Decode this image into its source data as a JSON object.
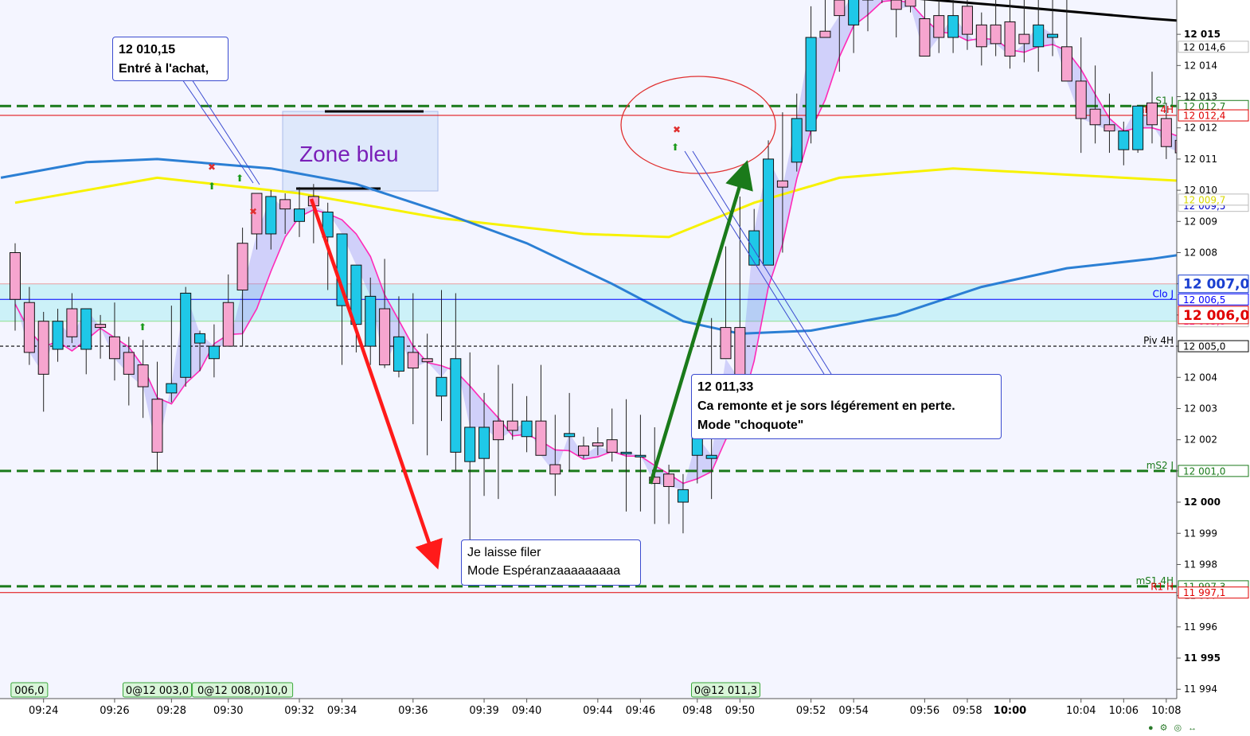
{
  "chart_data": {
    "type": "candlestick",
    "title": "",
    "xlabel": "",
    "ylabel": "",
    "ylim": [
      11993.7,
      12016.1
    ],
    "y_ticks": [
      "12 015",
      "12 014",
      "12 013",
      "12 012",
      "12 011",
      "12 010",
      "12 009",
      "12 008",
      "12 007",
      "12 006",
      "12 005",
      "12 004",
      "12 003",
      "12 002",
      "12 001",
      "12 000",
      "11 999",
      "11 998",
      "11 997",
      "11 996",
      "11 995",
      "11 994"
    ],
    "y_ticks_bold": [
      "12 015",
      "12 000",
      "11 995"
    ],
    "x_ticks": [
      {
        "label": "09:24",
        "idx": 2
      },
      {
        "label": "09:26",
        "idx": 7
      },
      {
        "label": "09:28",
        "idx": 11
      },
      {
        "label": "09:30",
        "idx": 15
      },
      {
        "label": "09:32",
        "idx": 20
      },
      {
        "label": "09:34",
        "idx": 23
      },
      {
        "label": "09:36",
        "idx": 28
      },
      {
        "label": "09:39",
        "idx": 33
      },
      {
        "label": "09:40",
        "idx": 36
      },
      {
        "label": "09:44",
        "idx": 41
      },
      {
        "label": "09:46",
        "idx": 44
      },
      {
        "label": "09:48",
        "idx": 48
      },
      {
        "label": "09:50",
        "idx": 51
      },
      {
        "label": "09:52",
        "idx": 56
      },
      {
        "label": "09:54",
        "idx": 59
      },
      {
        "label": "09:56",
        "idx": 64
      },
      {
        "label": "09:58",
        "idx": 67
      },
      {
        "label": "10:00",
        "idx": 70,
        "bold": true
      },
      {
        "label": "10:04",
        "idx": 75
      },
      {
        "label": "10:06",
        "idx": 78
      },
      {
        "label": "10:08",
        "idx": 81
      }
    ],
    "candles": [
      [
        12008.0,
        12008.3,
        12005.5,
        12006.5
      ],
      [
        12006.4,
        12006.9,
        12004.4,
        12004.8
      ],
      [
        12005.8,
        12006.1,
        12002.9,
        12004.1
      ],
      [
        12004.9,
        12006.2,
        12004.5,
        12005.8
      ],
      [
        12006.2,
        12006.7,
        12005.1,
        12005.3
      ],
      [
        12004.9,
        12006.2,
        12004.1,
        12006.2
      ],
      [
        12005.7,
        12006.0,
        12004.6,
        12005.6
      ],
      [
        12005.3,
        12006.4,
        12003.9,
        12004.6
      ],
      [
        12004.8,
        12005.3,
        12003.1,
        12004.1
      ],
      [
        12004.4,
        12005.2,
        12002.7,
        12003.7
      ],
      [
        12003.3,
        12004.5,
        12001.0,
        12001.6
      ],
      [
        12003.5,
        12006.3,
        12003.2,
        12003.8
      ],
      [
        12004.0,
        12006.9,
        12003.7,
        12006.7
      ],
      [
        12005.1,
        12005.5,
        12004.2,
        12005.4
      ],
      [
        12004.6,
        12005.7,
        12004.0,
        12005.0
      ],
      [
        12006.4,
        12007.3,
        12005.6,
        12005.0
      ],
      [
        12008.3,
        12008.8,
        12005.0,
        12006.8
      ],
      [
        12009.9,
        12009.9,
        12008.1,
        12008.6
      ],
      [
        12008.6,
        12010.0,
        12008.1,
        12009.8
      ],
      [
        12009.7,
        12009.9,
        12008.6,
        12009.4
      ],
      [
        12009.0,
        12010.1,
        12008.5,
        12009.4
      ],
      [
        12009.8,
        12010.2,
        12008.3,
        12009.5
      ],
      [
        12008.5,
        12009.6,
        12006.8,
        12009.3
      ],
      [
        12006.3,
        12007.2,
        12004.4,
        12008.6
      ],
      [
        12005.7,
        12007.6,
        12004.8,
        12007.6
      ],
      [
        12005.0,
        12007.2,
        12004.4,
        12006.6
      ],
      [
        12006.2,
        12007.8,
        12004.3,
        12004.4
      ],
      [
        12004.2,
        12006.6,
        12004.0,
        12005.3
      ],
      [
        12004.8,
        12006.7,
        12002.5,
        12004.3
      ],
      [
        12004.6,
        12005.4,
        12001.5,
        12004.5
      ],
      [
        12003.4,
        12006.8,
        12002.6,
        12004.0
      ],
      [
        12001.6,
        12006.7,
        12001.0,
        12004.6
      ],
      [
        12001.3,
        12004.8,
        11998.1,
        12002.4
      ],
      [
        12001.4,
        12003.5,
        12000.2,
        12002.4
      ],
      [
        12002.6,
        12004.4,
        12000.1,
        12002.0
      ],
      [
        12002.6,
        12003.8,
        12002.0,
        12002.3
      ],
      [
        12002.1,
        12003.4,
        12001.6,
        12002.6
      ],
      [
        12002.6,
        12004.4,
        12001.6,
        12001.5
      ],
      [
        12001.2,
        12002.8,
        12000.2,
        12000.9
      ],
      [
        12002.1,
        12003.5,
        12001.0,
        12002.2
      ],
      [
        12001.8,
        12002.1,
        12001.4,
        12001.5
      ],
      [
        12001.9,
        12002.4,
        12001.5,
        12001.8
      ],
      [
        12002.0,
        12003.0,
        12001.3,
        12001.6
      ],
      [
        12001.6,
        12003.3,
        11999.7,
        12001.6
      ],
      [
        12001.5,
        12002.8,
        11999.7,
        12001.5
      ],
      [
        12000.8,
        12002.4,
        11999.3,
        12000.6
      ],
      [
        12000.9,
        12001.2,
        11999.3,
        12000.5
      ],
      [
        12000.0,
        12000.9,
        11999.0,
        12000.4
      ],
      [
        12001.5,
        12003.3,
        12000.6,
        12002.1
      ],
      [
        12001.4,
        12005.9,
        12000.1,
        12001.5
      ],
      [
        12005.6,
        12008.2,
        12005.6,
        12004.6
      ],
      [
        12005.6,
        12009.8,
        12005.3,
        12003.9
      ],
      [
        12007.6,
        12009.4,
        12007.6,
        12008.7
      ],
      [
        12007.6,
        12011.6,
        12007.6,
        12011.0
      ],
      [
        12010.3,
        12012.5,
        12008.0,
        12010.1
      ],
      [
        12010.9,
        12013.1,
        12010.6,
        12012.3
      ],
      [
        12011.9,
        12015.9,
        12011.5,
        12014.9
      ],
      [
        12015.1,
        12016.8,
        12014.9,
        12014.9
      ],
      [
        12016.1,
        12016.9,
        12013.8,
        12015.6
      ],
      [
        12015.3,
        12016.9,
        12014.4,
        12016.3
      ],
      [
        12016.1,
        12017.6,
        12015.1,
        12016.3
      ],
      [
        12016.5,
        12017.8,
        12016.0,
        12016.6
      ],
      [
        12016.1,
        12017.0,
        12014.9,
        12015.8
      ],
      [
        12016.5,
        12017.9,
        12015.7,
        12015.9
      ],
      [
        12015.5,
        12016.2,
        12014.8,
        12014.3
      ],
      [
        12015.6,
        12016.2,
        12014.4,
        12014.9
      ],
      [
        12014.9,
        12016.3,
        12014.4,
        12015.6
      ],
      [
        12015.9,
        12016.7,
        12014.5,
        12015.0
      ],
      [
        12015.3,
        12015.7,
        12014.0,
        12014.6
      ],
      [
        12015.3,
        12016.2,
        12014.3,
        12014.7
      ],
      [
        12015.4,
        12016.7,
        12013.9,
        12014.3
      ],
      [
        12015.0,
        12016.2,
        12014.1,
        12014.7
      ],
      [
        12014.6,
        12016.2,
        12013.8,
        12015.3
      ],
      [
        12014.9,
        12016.2,
        12014.3,
        12015.0
      ],
      [
        12014.6,
        12016.1,
        12013.6,
        12013.5
      ],
      [
        12013.5,
        12014.9,
        12011.2,
        12012.3
      ],
      [
        12012.6,
        12014.0,
        12011.5,
        12012.1
      ],
      [
        12012.1,
        12013.1,
        12011.2,
        12011.9
      ],
      [
        12011.3,
        12012.2,
        12010.8,
        12011.9
      ],
      [
        12011.3,
        12012.2,
        12011.2,
        12012.7
      ],
      [
        12012.8,
        12013.8,
        12011.5,
        12012.1
      ],
      [
        12012.3,
        12012.8,
        12011.0,
        12011.4
      ],
      [
        12011.6,
        12012.6,
        12011.3,
        12011.2
      ]
    ],
    "candles_note": "",
    "series": [
      {
        "name": "",
        "color": "#ff2ab8"
      },
      {
        "name": "",
        "color": "#f7f200"
      },
      {
        "name": "",
        "color": "#2b7fd4"
      },
      {
        "name": "",
        "color": "#000000"
      }
    ],
    "levels": [
      {
        "label": "S1 J",
        "value": 12012.7,
        "box": "12 012,7",
        "color": "#1a7a1a",
        "style": "dashed"
      },
      {
        "label": "mR1 4H",
        "value": 12012.4,
        "box": "12 012,4",
        "color": "#e00000",
        "style": "solid"
      },
      {
        "label": "Clo J",
        "value": 12006.5,
        "box": "12 006,5",
        "color": "#0000ff",
        "style": "solid"
      },
      {
        "label": "Piv 4H",
        "value": 12005.0,
        "box": "12 005,0",
        "color": "#000000",
        "style": "dotted"
      },
      {
        "label": "mS2 J",
        "value": 12001.0,
        "box": "12 001,0",
        "color": "#1a7a1a",
        "style": "dashed"
      },
      {
        "label": "mS1 4H",
        "value": 11997.3,
        "box": "11 997,3",
        "color": "#1a7a1a",
        "style": "dashed"
      },
      {
        "label": "R1 H",
        "value": 11997.1,
        "box": "11 997,1",
        "color": "#e00000",
        "style": "solid"
      }
    ],
    "price_labels": [
      {
        "text": "12 014,6",
        "value": 12014.6,
        "color": "#000000",
        "bg": "#ffffff"
      },
      {
        "text": "12 009,5",
        "value": 12009.5,
        "color": "#0000cc",
        "bg": "#ffffff"
      },
      {
        "text": "12 009,7",
        "value": 12009.7,
        "color": "#d8d800",
        "bg": "#ffffff"
      },
      {
        "text": "12 005,8",
        "value": 12005.8,
        "color": "#ff2ab8",
        "bg": "#ffffff"
      },
      {
        "text": "12 007,0",
        "value": 12007.0,
        "color": "#1a3fd0",
        "bg": "#ffffff",
        "big": true
      },
      {
        "text": "12 006,0",
        "value": 12006.0,
        "color": "#e00000",
        "bg": "#ffffff",
        "big": true
      }
    ],
    "trade_tags": [
      {
        "text": "006,0",
        "idx": 1
      },
      {
        "text": "0@12 003,0",
        "idx": 10
      },
      {
        "text": "0@12 008,0)10,0",
        "idx": 16
      },
      {
        "text": "0@12 011,3",
        "idx": 50
      }
    ]
  },
  "annotations": {
    "callout_entry": {
      "line1": "12 010,15",
      "line2": "Entré à l'achat,"
    },
    "zone_label": "Zone bleu",
    "callout_exit": {
      "line1": "12 011,33",
      "line2": "Ca remonte et je sors légérement en perte.",
      "line3": "Mode \"choquote\""
    },
    "callout_hold": {
      "line1": "Je laisse filer",
      "line2": "Mode Espéranzaaaaaaaaa"
    }
  },
  "colors": {
    "up_candle": "#1fc8e8",
    "down_candle": "#f6a5cf",
    "plot_bg": "#f4f5ff",
    "zone_fill": "#bfeff5",
    "zone_blue_box": "#dbe6fb",
    "arrow_red": "#ff1a1a",
    "arrow_green": "#1a7a1a"
  }
}
